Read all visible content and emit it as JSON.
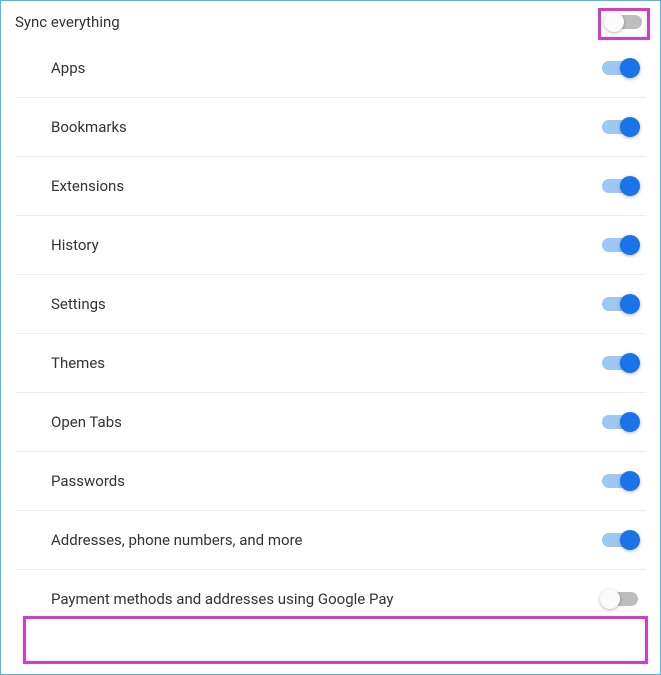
{
  "master": {
    "label": "Sync everything",
    "enabled": false
  },
  "items": [
    {
      "label": "Apps",
      "enabled": true
    },
    {
      "label": "Bookmarks",
      "enabled": true
    },
    {
      "label": "Extensions",
      "enabled": true
    },
    {
      "label": "History",
      "enabled": true
    },
    {
      "label": "Settings",
      "enabled": true
    },
    {
      "label": "Themes",
      "enabled": true
    },
    {
      "label": "Open Tabs",
      "enabled": true
    },
    {
      "label": "Passwords",
      "enabled": true
    },
    {
      "label": "Addresses, phone numbers, and more",
      "enabled": true
    },
    {
      "label": "Payment methods and addresses using Google Pay",
      "enabled": false
    }
  ]
}
